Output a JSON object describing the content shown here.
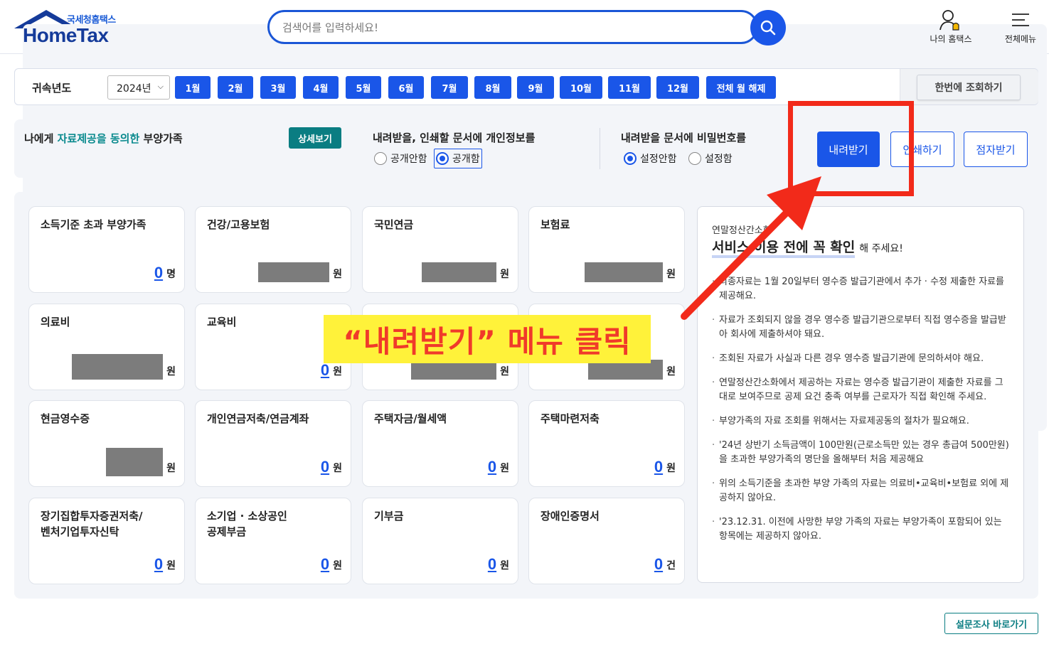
{
  "header": {
    "logo_sub": "국세청홈택스",
    "logo_main": "HomeTax",
    "search_placeholder": "검색어를 입력하세요!",
    "my_hometax": "나의 홈택스",
    "all_menu": "전체메뉴"
  },
  "filter": {
    "label": "귀속년도",
    "year": "2024년",
    "months": [
      "1월",
      "2월",
      "3월",
      "4월",
      "5월",
      "6월",
      "7월",
      "8월",
      "9월",
      "10월",
      "11월",
      "12월"
    ],
    "clear_all": "전체 월 해제",
    "query_all": "한번에 조회하기"
  },
  "dependents": {
    "prefix": "나에게 ",
    "highlight": "자료제공을 동의한",
    "suffix": " 부양가족",
    "detail_button": "상세보기"
  },
  "options": {
    "privacy_title": "내려받을, 인쇄할 문서에 개인정보를",
    "privacy_hide": "공개안함",
    "privacy_show": "공개함",
    "password_title": "내려받을 문서에 비밀번호를",
    "password_none": "설정안함",
    "password_set": "설정함",
    "download": "내려받기",
    "print": "인쇄하기",
    "braille": "점자받기"
  },
  "cards": [
    {
      "title": "소득기준 초과 부양가족",
      "value": "0",
      "unit": "명",
      "masked": false
    },
    {
      "title": "건강/고용보험",
      "value": "",
      "unit": "원",
      "masked": true
    },
    {
      "title": "국민연금",
      "value": "",
      "unit": "원",
      "masked": true
    },
    {
      "title": "보험료",
      "value": "",
      "unit": "원",
      "masked": true
    },
    {
      "title": "의료비",
      "value": "",
      "unit": "원",
      "masked": true
    },
    {
      "title": "교육비",
      "value": "0",
      "unit": "원",
      "masked": false
    },
    {
      "title": "",
      "value": "",
      "unit": "원",
      "masked": true
    },
    {
      "title": "",
      "value": "",
      "unit": "원",
      "masked": true
    },
    {
      "title": "현금영수증",
      "value": "",
      "unit": "원",
      "masked": true
    },
    {
      "title": "개인연금저축/연금계좌",
      "value": "0",
      "unit": "원",
      "masked": false
    },
    {
      "title": "주택자금/월세액",
      "value": "0",
      "unit": "원",
      "masked": false
    },
    {
      "title": "주택마련저축",
      "value": "0",
      "unit": "원",
      "masked": false
    },
    {
      "title": "장기집합투자증권저축/\n벤처기업투자신탁",
      "value": "0",
      "unit": "원",
      "masked": false
    },
    {
      "title": "소기업 · 소상공인\n공제부금",
      "value": "0",
      "unit": "원",
      "masked": false
    },
    {
      "title": "기부금",
      "value": "0",
      "unit": "원",
      "masked": false
    },
    {
      "title": "장애인증명서",
      "value": "0",
      "unit": "건",
      "masked": false
    }
  ],
  "notice": {
    "small": "연말정산간소화",
    "head": "서비스 이용 전에 꼭 확인",
    "head_suffix": "해 주세요!",
    "items": [
      "최종자료는 1월 20일부터 영수증 발급기관에서 추가 · 수정 제출한 자료를 제공해요.",
      "자료가 조회되지 않을 경우 영수증 발급기관으로부터 직접 영수증을 발급받아 회사에 제출하셔야 돼요.",
      "조회된 자료가 사실과 다른 경우 영수증 발급기관에 문의하셔야 해요.",
      "연말정산간소화에서 제공하는 자료는 영수증 발급기관이 제출한 자료를 그대로 보여주므로 공제 요건 충족 여부를 근로자가 직접 확인해 주세요.",
      "부양가족의 자료 조회를 위해서는 자료제공동의 절차가 필요해요.",
      "'24년 상반기 소득금액이 100만원(근로소득만 있는 경우 총급여 500만원)을 초과한 부양가족의 명단을 올해부터 처음 제공해요",
      "위의 소득기준을 초과한 부양 가족의 자료는 의료비•교육비•보험료 외에 제공하지 않아요.",
      "'23.12.31. 이전에 사망한 부양 가족의 자료는 부양가족이 포함되어 있는 항목에는 제공하지 않아요."
    ]
  },
  "survey": "설문조사 바로가기",
  "callout": "“내려받기” 메뉴 클릭",
  "colors": {
    "primary": "#1a56e8",
    "teal": "#0a7d82",
    "highlight_red": "#f22a1a",
    "callout_yellow": "#fff23a"
  }
}
